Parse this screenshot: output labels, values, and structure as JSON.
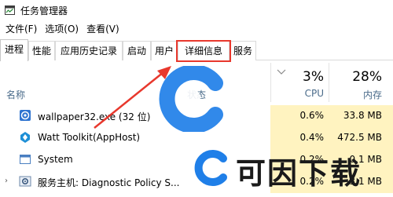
{
  "window": {
    "title": "任务管理器"
  },
  "menu": [
    "文件(F)",
    "选项(O)",
    "查看(V)"
  ],
  "tabs": [
    "进程",
    "性能",
    "应用历史记录",
    "启动",
    "用户",
    "详细信息",
    "服务"
  ],
  "active_tab": "进程",
  "highlighted_tab": "详细信息",
  "columns": {
    "name": "名称",
    "status": "状态",
    "cpu_pct": "3%",
    "cpu_label": "CPU",
    "mem_pct": "28%",
    "mem_label": "内存"
  },
  "rows": [
    {
      "name": "wallpaper32.exe (32 位)",
      "cpu": "0.6%",
      "mem": "33.8 MB",
      "icon": "wallpaper-app-icon"
    },
    {
      "name": "Watt Toolkit(AppHost)",
      "cpu": "0.4%",
      "mem": "472.5 MB",
      "icon": "watt-toolkit-icon"
    },
    {
      "name": "System",
      "cpu": "0.2%",
      "mem": "0.1 MB",
      "icon": "system-window-icon"
    },
    {
      "name": "服务主机: Diagnostic Policy S...",
      "cpu": "0.2%",
      "mem": "3.1 MB",
      "icon": "service-host-gear-icon"
    }
  ],
  "watermark": {
    "text": "可因下载"
  },
  "colors": {
    "highlight": "#e8382d",
    "cell_bg": "#fff3c0",
    "header_label": "#4a6b8a",
    "watermark_blue": "#1f7fe8"
  }
}
